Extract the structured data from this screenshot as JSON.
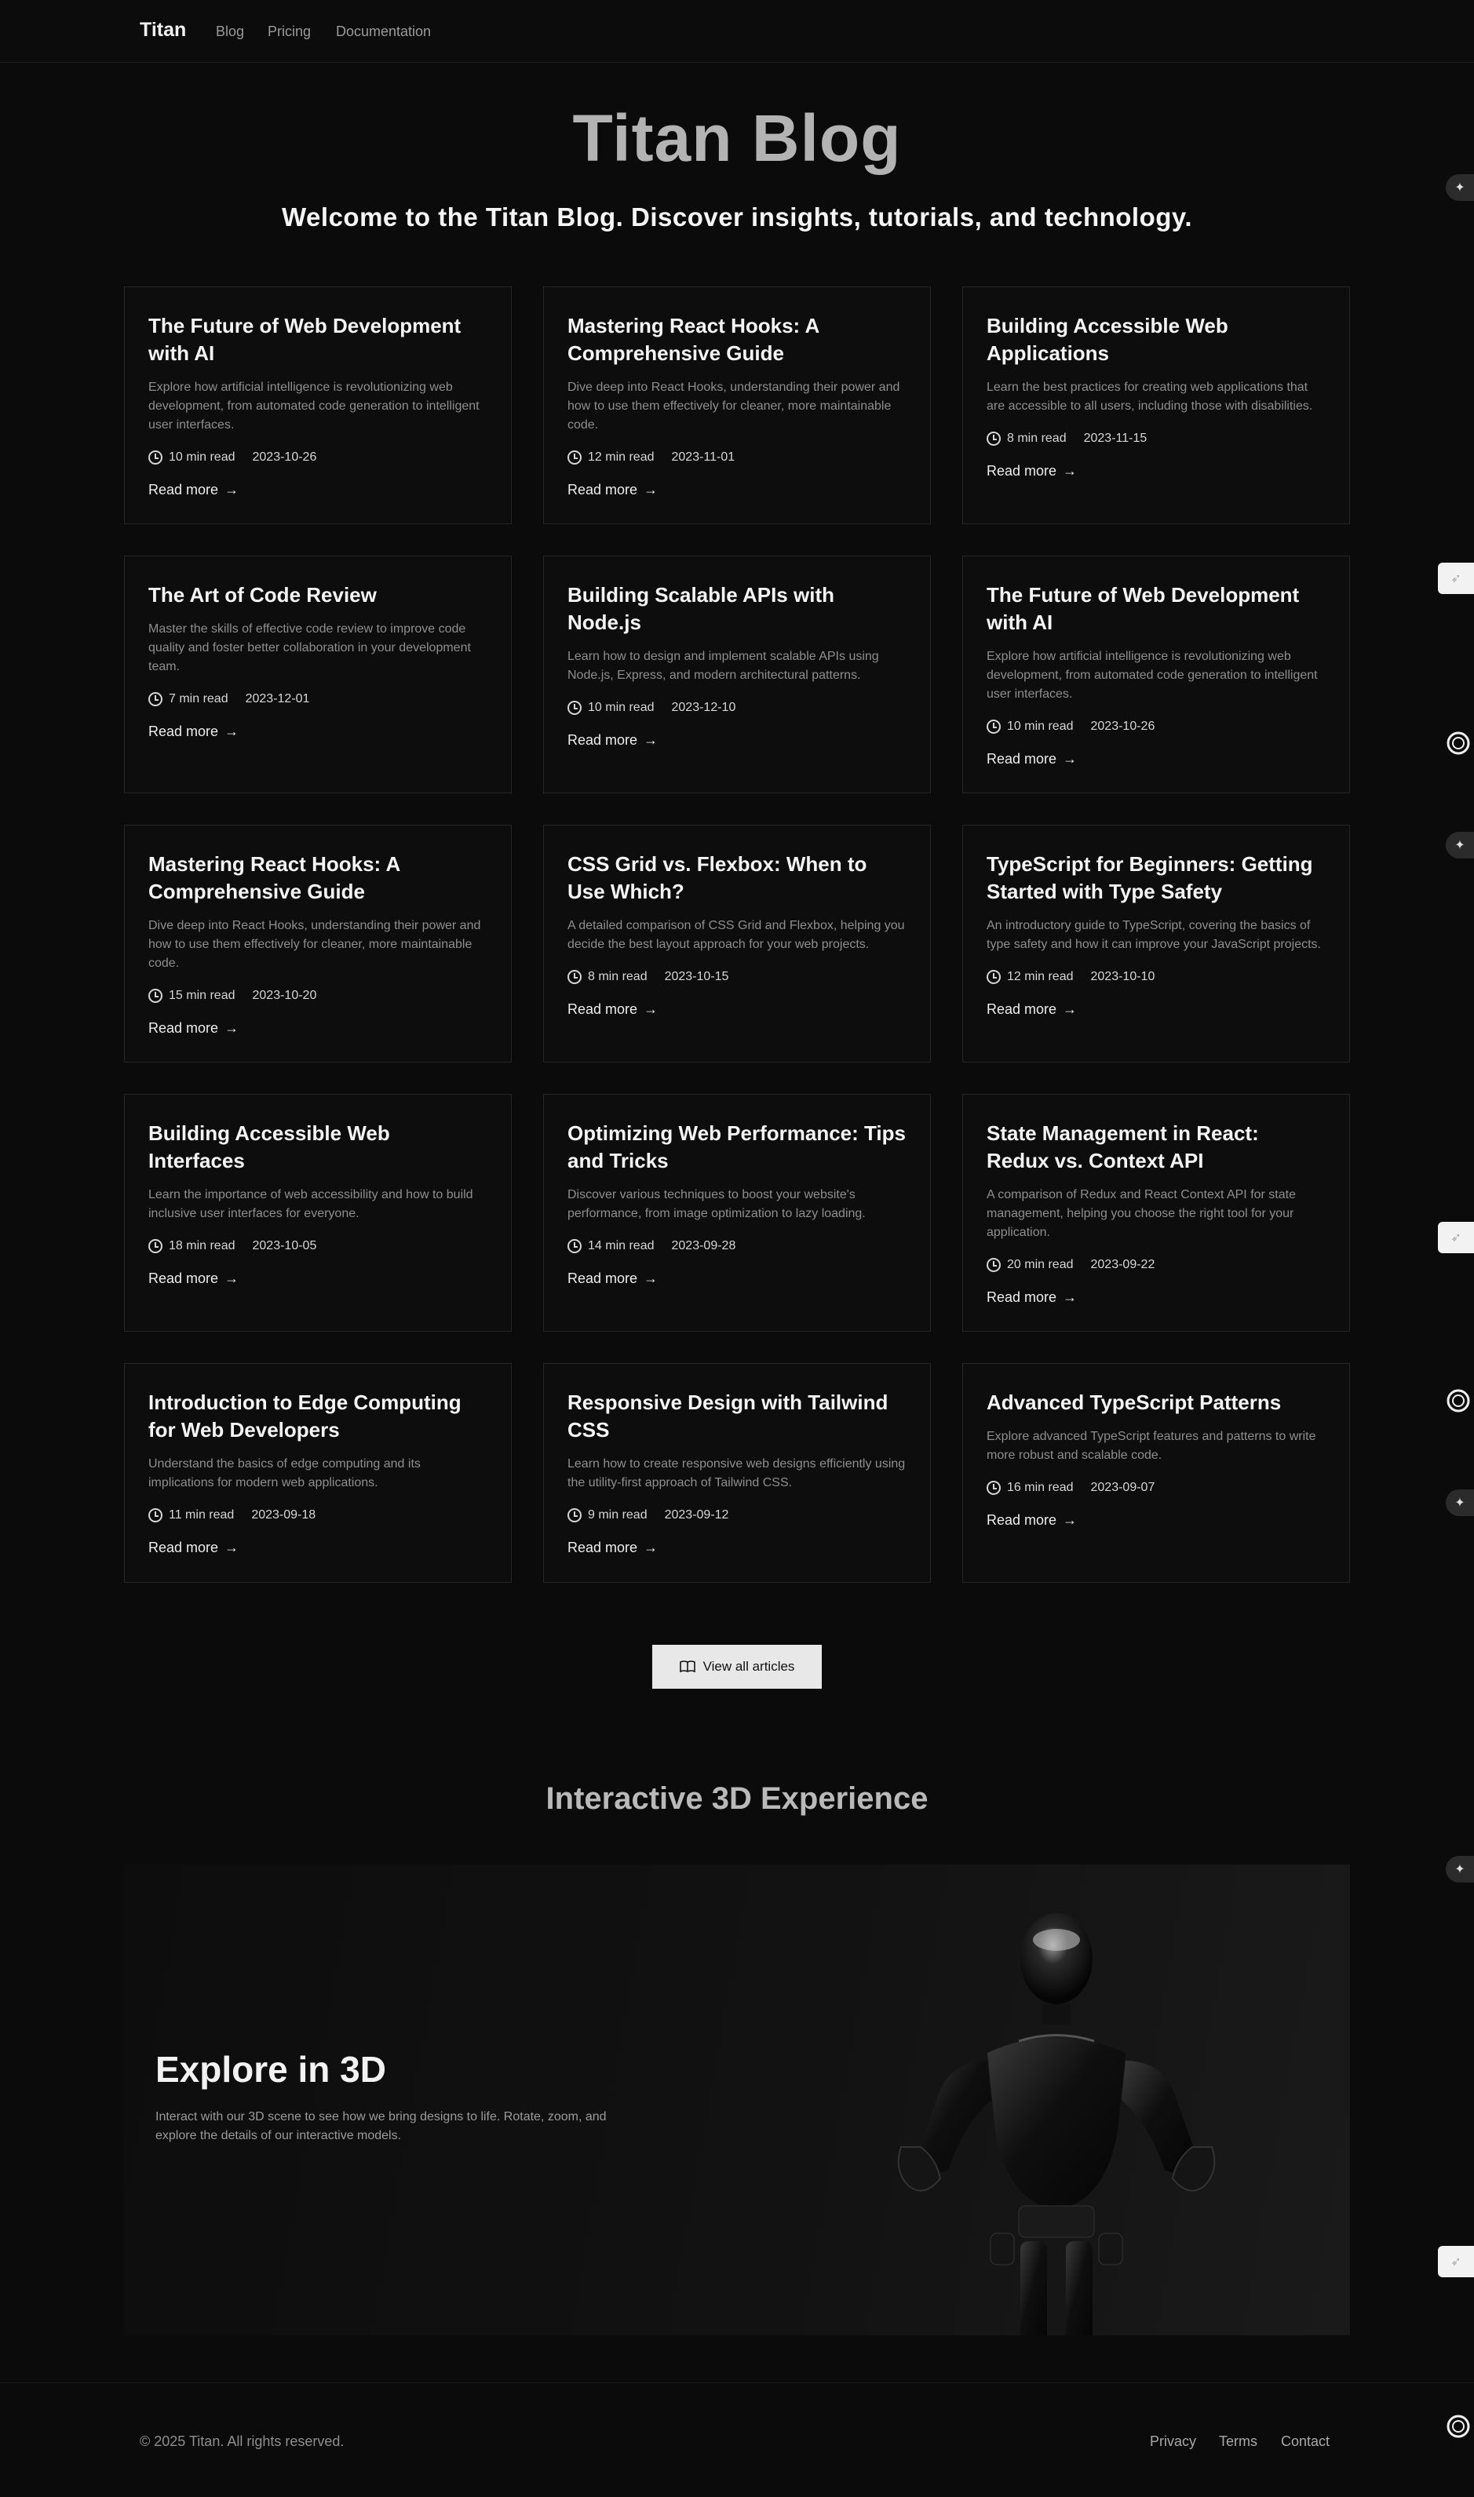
{
  "nav": {
    "brand": "Titan",
    "links": [
      "Blog",
      "Pricing",
      "Documentation"
    ]
  },
  "hero": {
    "title": "Titan Blog",
    "subtitle": "Welcome to the Titan Blog. Discover insights, tutorials, and technology."
  },
  "read_more_label": "Read more",
  "articles": [
    {
      "title": "The Future of Web Development with AI",
      "desc": "Explore how artificial intelligence is revolutionizing web development, from automated code generation to intelligent user interfaces.",
      "read": "10 min read",
      "date": "2023-10-26"
    },
    {
      "title": "Mastering React Hooks: A Comprehensive Guide",
      "desc": "Dive deep into React Hooks, understanding their power and how to use them effectively for cleaner, more maintainable code.",
      "read": "12 min read",
      "date": "2023-11-01"
    },
    {
      "title": "Building Accessible Web Applications",
      "desc": "Learn the best practices for creating web applications that are accessible to all users, including those with disabilities.",
      "read": "8 min read",
      "date": "2023-11-15"
    },
    {
      "title": "The Art of Code Review",
      "desc": "Master the skills of effective code review to improve code quality and foster better collaboration in your development team.",
      "read": "7 min read",
      "date": "2023-12-01"
    },
    {
      "title": "Building Scalable APIs with Node.js",
      "desc": "Learn how to design and implement scalable APIs using Node.js, Express, and modern architectural patterns.",
      "read": "10 min read",
      "date": "2023-12-10"
    },
    {
      "title": "The Future of Web Development with AI",
      "desc": "Explore how artificial intelligence is revolutionizing web development, from automated code generation to intelligent user interfaces.",
      "read": "10 min read",
      "date": "2023-10-26"
    },
    {
      "title": "Mastering React Hooks: A Comprehensive Guide",
      "desc": "Dive deep into React Hooks, understanding their power and how to use them effectively for cleaner, more maintainable code.",
      "read": "15 min read",
      "date": "2023-10-20"
    },
    {
      "title": "CSS Grid vs. Flexbox: When to Use Which?",
      "desc": "A detailed comparison of CSS Grid and Flexbox, helping you decide the best layout approach for your web projects.",
      "read": "8 min read",
      "date": "2023-10-15"
    },
    {
      "title": "TypeScript for Beginners: Getting Started with Type Safety",
      "desc": "An introductory guide to TypeScript, covering the basics of type safety and how it can improve your JavaScript projects.",
      "read": "12 min read",
      "date": "2023-10-10"
    },
    {
      "title": "Building Accessible Web Interfaces",
      "desc": "Learn the importance of web accessibility and how to build inclusive user interfaces for everyone.",
      "read": "18 min read",
      "date": "2023-10-05"
    },
    {
      "title": "Optimizing Web Performance: Tips and Tricks",
      "desc": "Discover various techniques to boost your website's performance, from image optimization to lazy loading.",
      "read": "14 min read",
      "date": "2023-09-28"
    },
    {
      "title": "State Management in React: Redux vs. Context API",
      "desc": "A comparison of Redux and React Context API for state management, helping you choose the right tool for your application.",
      "read": "20 min read",
      "date": "2023-09-22"
    },
    {
      "title": "Introduction to Edge Computing for Web Developers",
      "desc": "Understand the basics of edge computing and its implications for modern web applications.",
      "read": "11 min read",
      "date": "2023-09-18"
    },
    {
      "title": "Responsive Design with Tailwind CSS",
      "desc": "Learn how to create responsive web designs efficiently using the utility-first approach of Tailwind CSS.",
      "read": "9 min read",
      "date": "2023-09-12"
    },
    {
      "title": "Advanced TypeScript Patterns",
      "desc": "Explore advanced TypeScript features and patterns to write more robust and scalable code.",
      "read": "16 min read",
      "date": "2023-09-07"
    }
  ],
  "view_all_label": "View all articles",
  "experience": {
    "section_title": "Interactive 3D Experience",
    "title": "Explore in 3D",
    "desc": "Interact with our 3D scene to see how we bring designs to life. Rotate, zoom, and explore the details of our interactive models."
  },
  "footer": {
    "copyright": "© 2025 Titan. All rights reserved.",
    "links": [
      "Privacy",
      "Terms",
      "Contact"
    ]
  },
  "icons": {
    "clock": "clock-icon",
    "arrow": "arrow-right-icon",
    "book": "book-open-icon",
    "side_widgets": [
      "sparkle-icon",
      "rocket-icon",
      "ring-icon"
    ]
  },
  "colors": {
    "background": "#0b0b0b",
    "card_border": "#262626",
    "hero_title": "#b3b3b3",
    "button_bg": "#e8e8e8"
  }
}
